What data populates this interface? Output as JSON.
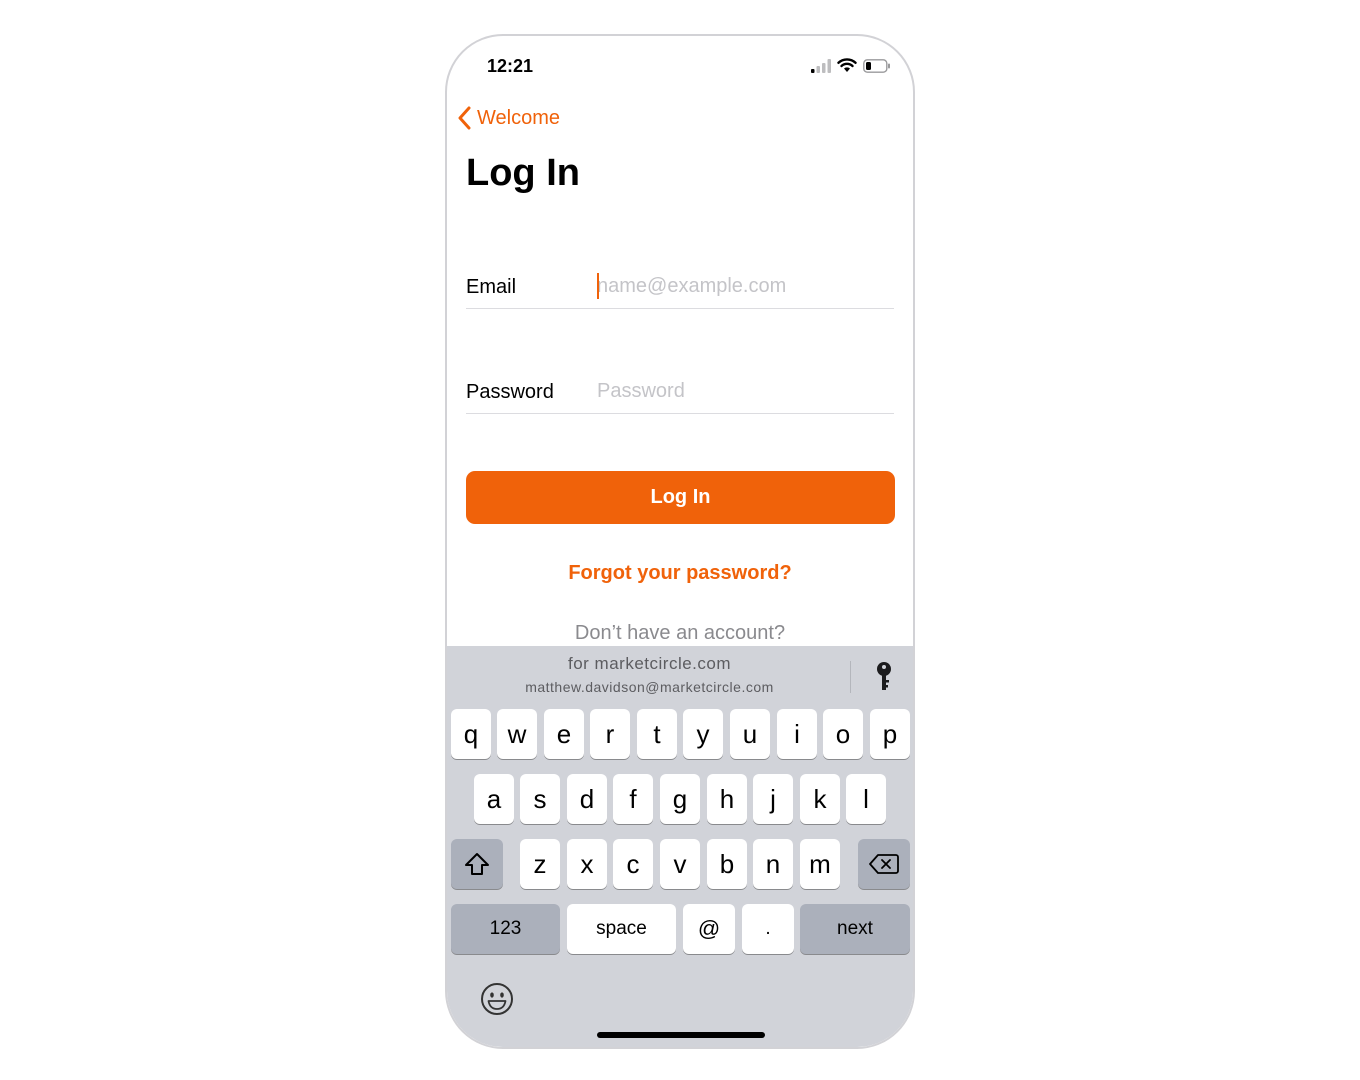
{
  "status_bar": {
    "time": "12:21"
  },
  "nav": {
    "back_label": "Welcome"
  },
  "page": {
    "title": "Log In"
  },
  "form": {
    "email_label": "Email",
    "email_placeholder": "name@example.com",
    "password_label": "Password",
    "password_placeholder": "Password",
    "submit_label": "Log In",
    "forgot_label": "Forgot your password?",
    "no_account_label": "Don’t have an account?"
  },
  "keyboard": {
    "suggestion_title": "for marketcircle.com",
    "suggestion_email": "matthew.davidson@marketcircle.com",
    "row1": [
      "q",
      "w",
      "e",
      "r",
      "t",
      "y",
      "u",
      "i",
      "o",
      "p"
    ],
    "row2": [
      "a",
      "s",
      "d",
      "f",
      "g",
      "h",
      "j",
      "k",
      "l"
    ],
    "row3": [
      "z",
      "x",
      "c",
      "v",
      "b",
      "n",
      "m"
    ],
    "numbers_label": "123",
    "space_label": "space",
    "at_label": "@",
    "dot_label": ".",
    "next_label": "next"
  },
  "colors": {
    "accent": "#f0620a",
    "keyboard_bg": "#d1d3d9",
    "key_dark": "#abb0bb"
  },
  "icons": [
    "signal-icon",
    "wifi-icon",
    "battery-icon",
    "chevron-left-icon",
    "key-icon",
    "shift-icon",
    "backspace-icon",
    "emoji-icon"
  ]
}
